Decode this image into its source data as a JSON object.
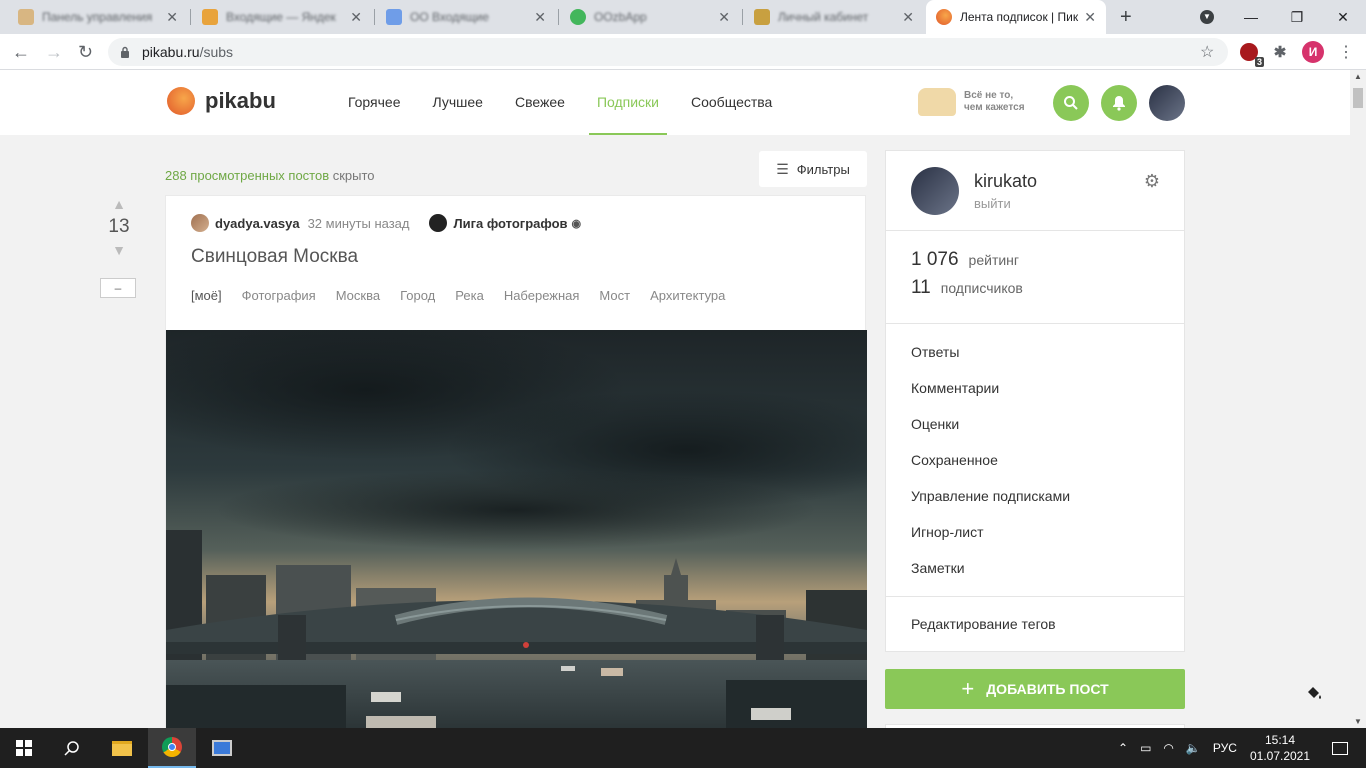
{
  "browser": {
    "tabs": [
      {
        "title": "Панель управления",
        "favicon_color": "#d8b682"
      },
      {
        "title": "Входящие — Яндекс",
        "favicon_color": "#e8a33c"
      },
      {
        "title": "ОО Входящие",
        "favicon_color": "#6f9de8"
      },
      {
        "title": "OOzbApp",
        "favicon_color": "#43b65c"
      },
      {
        "title": "Личный кабинет",
        "favicon_color": "#c8a040"
      },
      {
        "title": "Лента подписок | Пик",
        "favicon_color": "#e1582a"
      }
    ],
    "url_host": "pikabu.ru",
    "url_path": "/subs",
    "ext_badge": "3",
    "profile_letter": "И"
  },
  "site": {
    "logo_text": "pikabu",
    "nav": [
      "Горячее",
      "Лучшее",
      "Свежее",
      "Подписки",
      "Сообщества"
    ],
    "nav_active": 3,
    "promo_line1": "Всё не то,",
    "promo_line2": "чем кажется",
    "accent_color": "#8ac858"
  },
  "feed": {
    "hidden_count_link": "288 просмотренных постов",
    "hidden_suffix": " скрыто",
    "filters_label": "Фильтры"
  },
  "post": {
    "rating": "13",
    "minus_label": "–",
    "author": "dyadya.vasya",
    "time": "32 минуты назад",
    "community": "Лига фотографов",
    "title": "Свинцовая Москва",
    "tags": [
      "[моё]",
      "Фотография",
      "Москва",
      "Город",
      "Река",
      "Набережная",
      "Мост",
      "Архитектура"
    ]
  },
  "profile": {
    "username": "kirukato",
    "logout": "выйти",
    "rating_value": "1 076",
    "rating_label": "рейтинг",
    "subs_value": "11",
    "subs_label": "подписчиков",
    "menu": [
      "Ответы",
      "Комментарии",
      "Оценки",
      "Сохраненное",
      "Управление подписками",
      "Игнор-лист",
      "Заметки"
    ],
    "edit_tags": "Редактирование тегов",
    "add_post": "ДОБАВИТЬ ПОСТ"
  },
  "taskbar": {
    "lang": "РУС",
    "time": "15:14",
    "date": "01.07.2021"
  }
}
